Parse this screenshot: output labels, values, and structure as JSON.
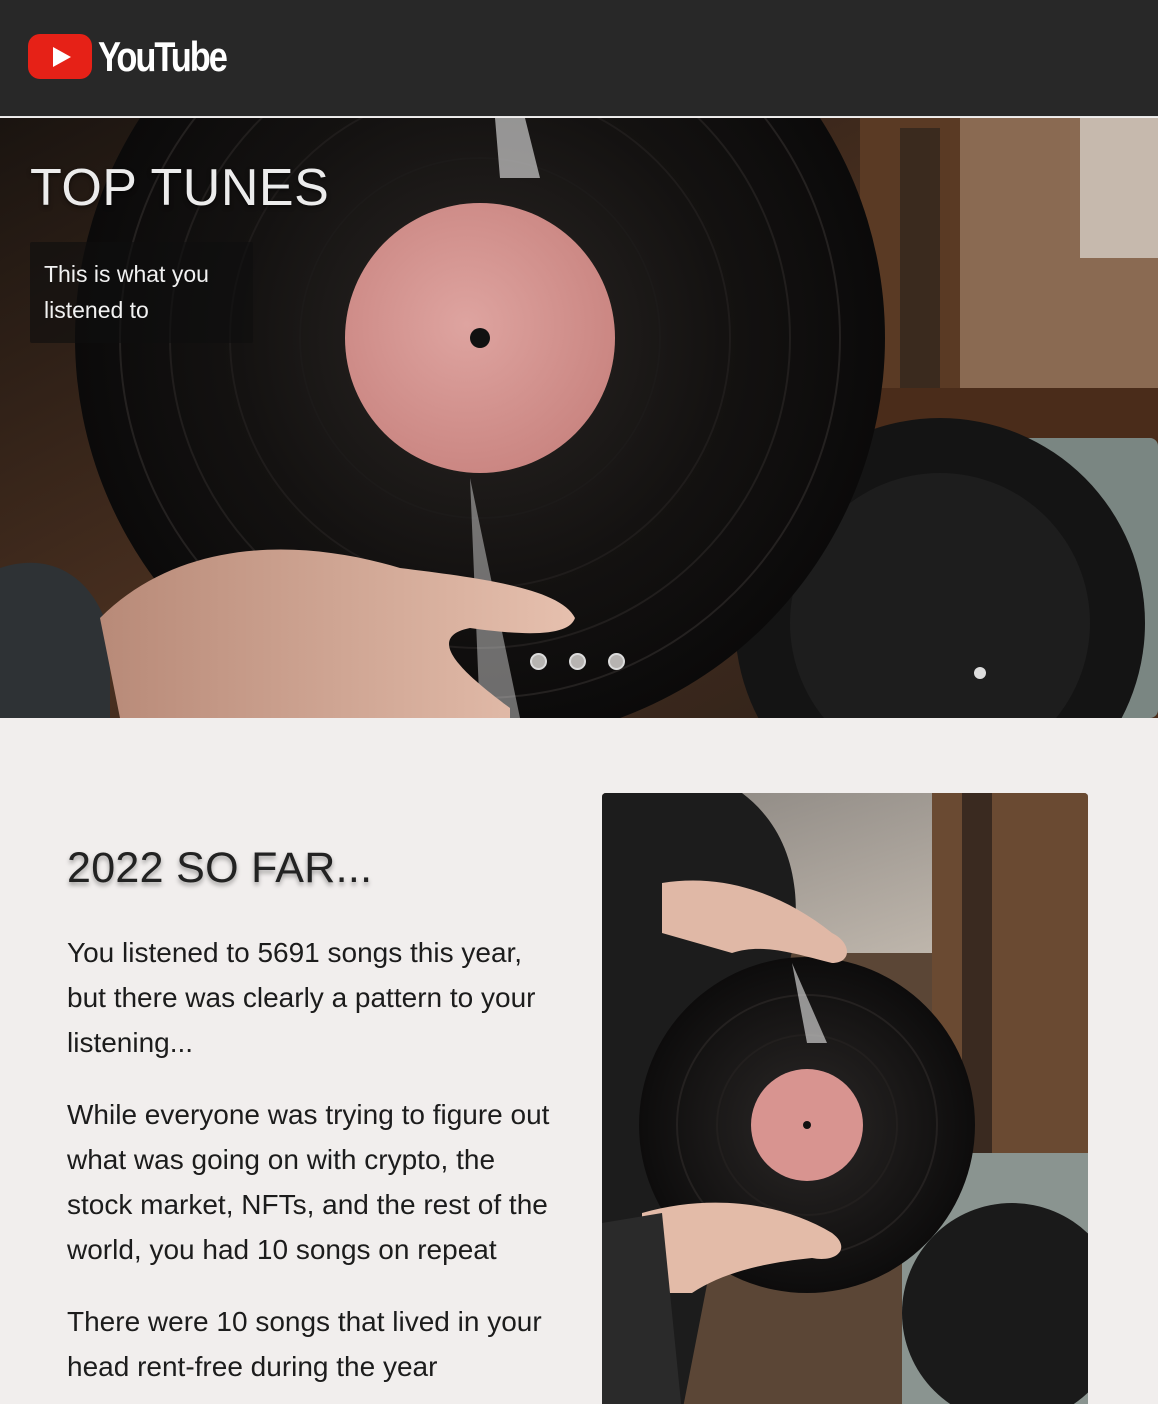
{
  "header": {
    "logo_text": "YouTube",
    "logo_color": "#e62117"
  },
  "hero": {
    "title": "TOP TUNES",
    "caption": "This is what you listened to",
    "carousel_dots": 3
  },
  "main": {
    "title": "2022 SO FAR...",
    "paragraphs": [
      "You listened to 5691 songs this year, but there was clearly a pattern to your listening...",
      "While everyone was trying to figure out what was going on with crypto, the stock market, NFTs, and the rest of the world, you had 10 songs on repeat",
      "There were 10 songs that lived in your head rent-free during the year"
    ]
  },
  "icons": {
    "logo": "youtube-play-icon"
  }
}
